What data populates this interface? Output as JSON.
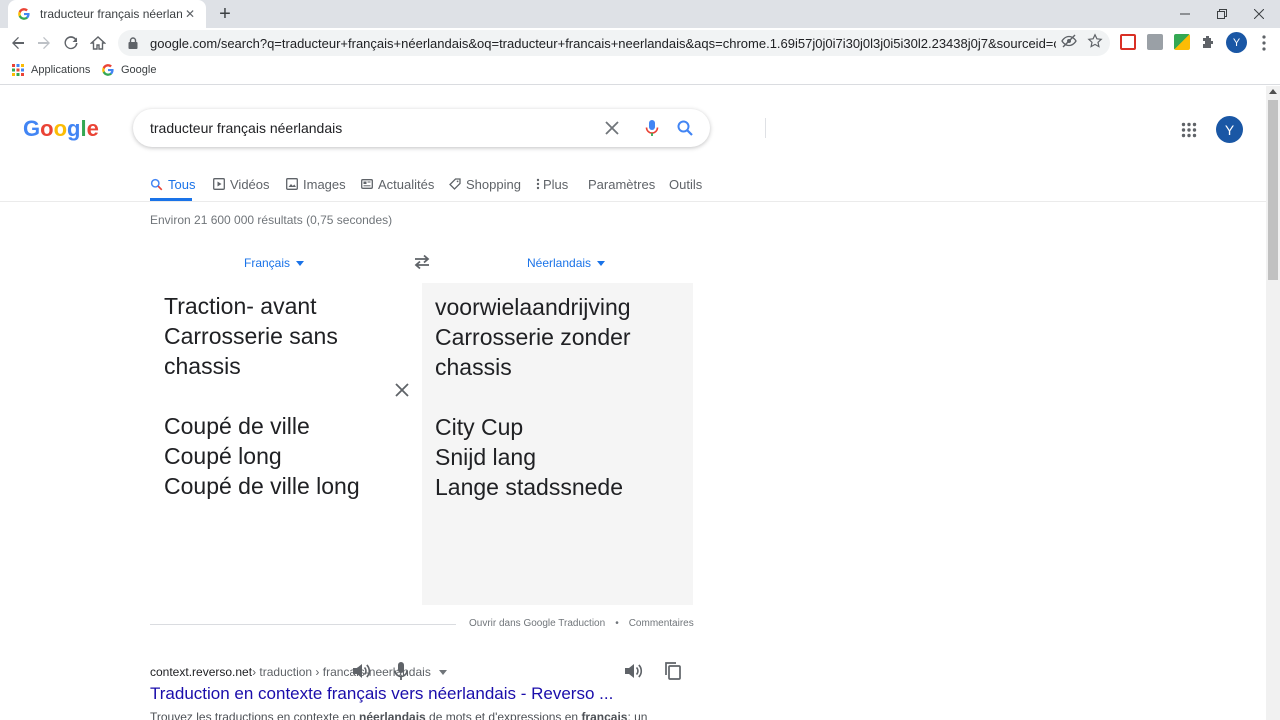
{
  "browser": {
    "tab_title": "traducteur français néerlandais -",
    "favicon_letter": "G",
    "url": "google.com/search?q=traducteur+français+néerlandais&oq=traducteur+francais+neerlandais&aqs=chrome.1.69i57j0j0i7i30j0l3j0i5i30l2.23438j0j7&sourceid=chrome&ie=UT...",
    "profile_letter": "Y",
    "bookmarks": [
      "Applications",
      "Google"
    ]
  },
  "search": {
    "logo": "Google",
    "query": "traducteur français néerlandais",
    "avatar_letter": "Y"
  },
  "tabs": [
    {
      "label": "Tous",
      "icon": "search-icon",
      "active": true
    },
    {
      "label": "Vidéos",
      "icon": "video-icon"
    },
    {
      "label": "Images",
      "icon": "image-icon"
    },
    {
      "label": "Actualités",
      "icon": "news-icon"
    },
    {
      "label": "Shopping",
      "icon": "tag-icon"
    },
    {
      "label": "Plus",
      "icon": "more-vert-icon"
    },
    {
      "label": "Paramètres"
    },
    {
      "label": "Outils"
    }
  ],
  "result_stats": "Environ 21 600 000 résultats (0,75 secondes)",
  "translator": {
    "source_lang": "Français",
    "target_lang": "Néerlandais",
    "source_lines": [
      "Traction- avant",
      "Carrosserie sans",
      "chassis",
      "",
      "Coupé de ville",
      "Coupé long",
      "Coupé de ville long"
    ],
    "target_lines": [
      "voorwielaandrijving",
      "Carrosserie zonder",
      "chassis",
      "",
      "City Cup",
      "Snijd lang",
      "Lange stadssnede"
    ],
    "open_link": "Ouvrir dans Google Traduction",
    "separator": "•",
    "feedback": "Commentaires"
  },
  "result": {
    "domain": "context.reverso.net",
    "path": " › traduction › francais-neerlandais",
    "title": "Traduction en contexte français vers néerlandais - Reverso ...",
    "snippet_1": "Trouvez les traductions en contexte en ",
    "snippet_bold_1": "néerlandais",
    "snippet_2": " de mots et d'expressions en ",
    "snippet_bold_2": "français",
    "snippet_3": "; un"
  },
  "colors": {
    "accent": "#1a73e8",
    "link": "#1a0dab",
    "avatar": "#1a57a5"
  }
}
